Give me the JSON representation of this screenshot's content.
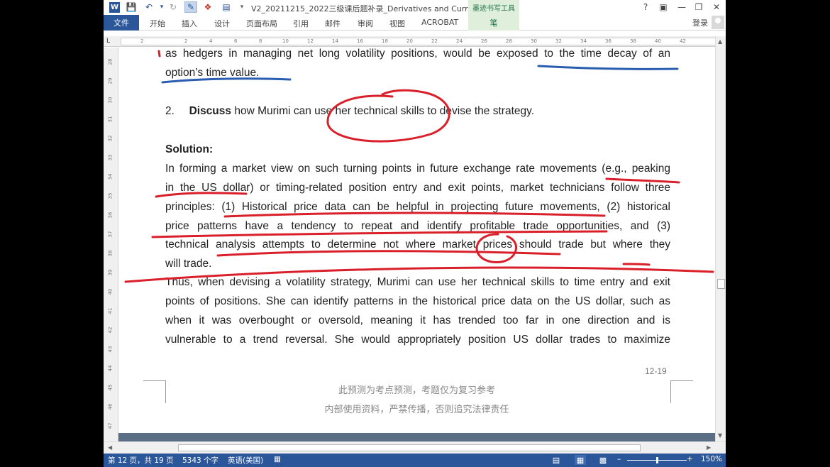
{
  "titlebar": {
    "logo": "W",
    "quick_access": [
      "save-icon",
      "undo-icon",
      "redo-icon",
      "ink-pen-icon",
      "eraser-icon",
      "layout-icon"
    ],
    "doc_title": "V2_20211215_2022三级课后题补录_Derivatives and Curren...",
    "context_tools": "墨迹书写工具",
    "help": "?"
  },
  "ribbon": {
    "file_tab": "文件",
    "tabs": [
      "开始",
      "插入",
      "设计",
      "页面布局",
      "引用",
      "邮件",
      "审阅",
      "视图",
      "ACROBAT"
    ],
    "ink_tab": "笔",
    "login": "登录"
  },
  "ruler": {
    "marks": [
      "2",
      "2",
      "4",
      "6",
      "8",
      "10",
      "12",
      "14",
      "16",
      "18",
      "20",
      "22",
      "24",
      "26",
      "28",
      "30",
      "32",
      "34",
      "36",
      "38",
      "40",
      "42"
    ],
    "vmarks": [
      "28",
      "29",
      "30",
      "31",
      "32",
      "33",
      "34",
      "35",
      "36",
      "37",
      "38",
      "39",
      "40",
      "41",
      "42",
      "43",
      "44",
      "45",
      "46",
      "47"
    ]
  },
  "document": {
    "lines": [
      "as hedgers in managing net long volatility positions, would be exposed to the time decay of an",
      "option’s time value."
    ],
    "question_number": "2.",
    "question_bold": "Discuss",
    "question_rest": " how Murimi can use her technical skills to devise the strategy.",
    "solution_heading": "Solution:",
    "para1": [
      "In forming a market view on such turning points in future exchange rate movements (e.g., peaking",
      "in the US dollar) or timing-related position entry and exit points, market technicians follow three",
      "principles: (1) Historical price data can be helpful in projecting future movements, (2) historical",
      "price patterns have a tendency to repeat and identify profitable trade opportunities, and (3)",
      "technical analysis attempts to determine not where market prices should trade but where they",
      "will trade."
    ],
    "para2": [
      "Thus, when devising a volatility strategy, Murimi can use her technical skills to time entry and exit",
      "points of positions. She can identify patterns in the historical price data on the US dollar, such as",
      "when it was overbought or oversold, meaning it has trended too far in one direction and is",
      "vulnerable to a trend reversal. She would appropriately position US dollar trades to maximize"
    ],
    "page_number": "12-19",
    "footer_line1": "此预测为考点预测，考题仅为复习参考",
    "footer_line2": "内部使用资料，严禁传播，否则追究法律责任"
  },
  "ink": {
    "red": "#d9202a",
    "blue": "#2a5db0"
  },
  "status": {
    "page": "第 12 页，共 19 页",
    "words": "5343 个字",
    "language": "英语(美国)",
    "zoom": "150%",
    "zoom_level": 0.5
  },
  "colors": {
    "accent": "#2b579a",
    "ink_tools": "#217346"
  }
}
